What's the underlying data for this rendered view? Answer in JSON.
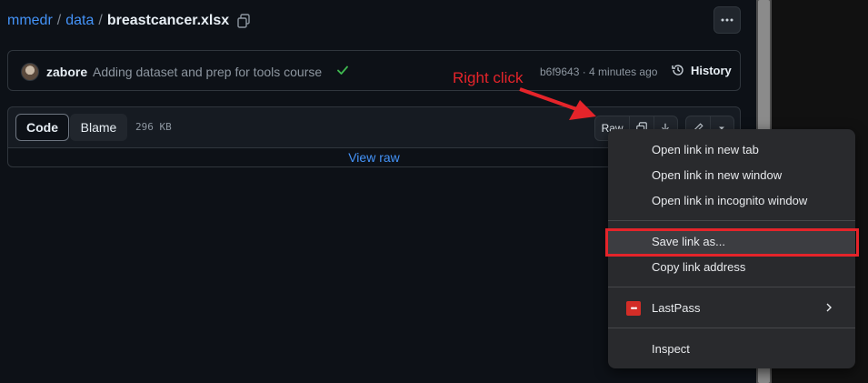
{
  "breadcrumb": {
    "owner": "mmedr",
    "separator": "/",
    "folder": "data",
    "file": "breastcancer.xlsx"
  },
  "commit": {
    "author": "zabore",
    "message": "Adding dataset and prep for tools course",
    "hash_time": "b6f9643 · 4 minutes ago",
    "history_label": "History"
  },
  "file_header": {
    "code_tab": "Code",
    "blame_tab": "Blame",
    "size": "296 KB",
    "raw_label": "Raw",
    "view_raw": "View raw"
  },
  "annotation": {
    "label": "Right click",
    "color": "#e5242a"
  },
  "context_menu": {
    "items": [
      {
        "label": "Open link in new tab"
      },
      {
        "label": "Open link in new window"
      },
      {
        "label": "Open link in incognito window"
      },
      {
        "label": "Save link as..."
      },
      {
        "label": "Copy link address"
      },
      {
        "label": "LastPass",
        "icon": "lastpass-icon",
        "icon_text": "•••"
      },
      {
        "label": "Inspect"
      }
    ],
    "highlighted_item": "Save link as..."
  },
  "colors": {
    "link": "#4493f8",
    "background": "#0d1117",
    "menu_bg": "#292a2d",
    "success": "#3fb950"
  }
}
